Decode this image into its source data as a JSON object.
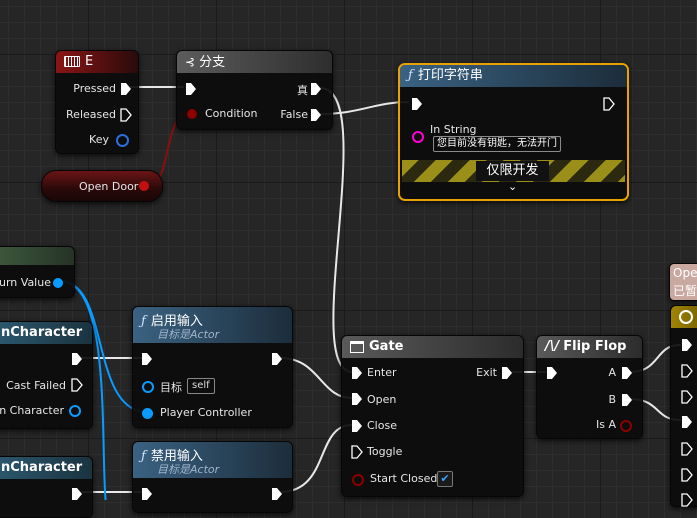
{
  "nodes": {
    "key_e": {
      "title": "E",
      "pressed": "Pressed",
      "released": "Released",
      "key": "Key"
    },
    "branch": {
      "title": "分支",
      "condition": "Condition",
      "true_label": "真",
      "false_label": "False"
    },
    "print_string": {
      "title": "打印字符串",
      "in_string_label": "In String",
      "in_string_value": "您目前没有钥匙，无法开门",
      "dev_only": "仅限开发"
    },
    "open_door_var": {
      "label": "Open Door"
    },
    "return_value": {
      "label": "urn Value"
    },
    "cast1": {
      "title": "nCharacter",
      "cast_failed": "Cast Failed",
      "as_character": "on Character"
    },
    "cast2": {
      "title": "nCharacter"
    },
    "enable_input": {
      "title": "启用输入",
      "subtitle": "目标是Actor",
      "target": "目标",
      "target_value": "self",
      "player_controller": "Player Controller"
    },
    "disable_input": {
      "title": "禁用输入",
      "subtitle": "目标是Actor"
    },
    "gate": {
      "title": "Gate",
      "enter": "Enter",
      "open": "Open",
      "close": "Close",
      "toggle": "Toggle",
      "exit": "Exit",
      "start_closed": "Start Closed"
    },
    "flipflop": {
      "title": "Flip Flop",
      "a": "A",
      "b": "B",
      "is_a": "Is A"
    },
    "open_var_right": {
      "line1": "Ope",
      "line2": "已暂"
    }
  },
  "colors": {
    "exec": "#ffffff",
    "bool": "#8c0000",
    "string": "#ff00d4",
    "object": "#0a9bff",
    "struct": "#2a6fdd",
    "key_header": "#7a1010",
    "branch_header": "#555555",
    "function_header": "#2c4a63",
    "selected_border": "#e8a300",
    "macro_header": "#4d4d4d"
  },
  "icons": {
    "key_e": "keyboard-icon",
    "branch": "branch-icon",
    "function": "function-icon",
    "gate": "gate-icon",
    "flipflop": "flipflop-icon",
    "timeline": "clock-icon"
  }
}
